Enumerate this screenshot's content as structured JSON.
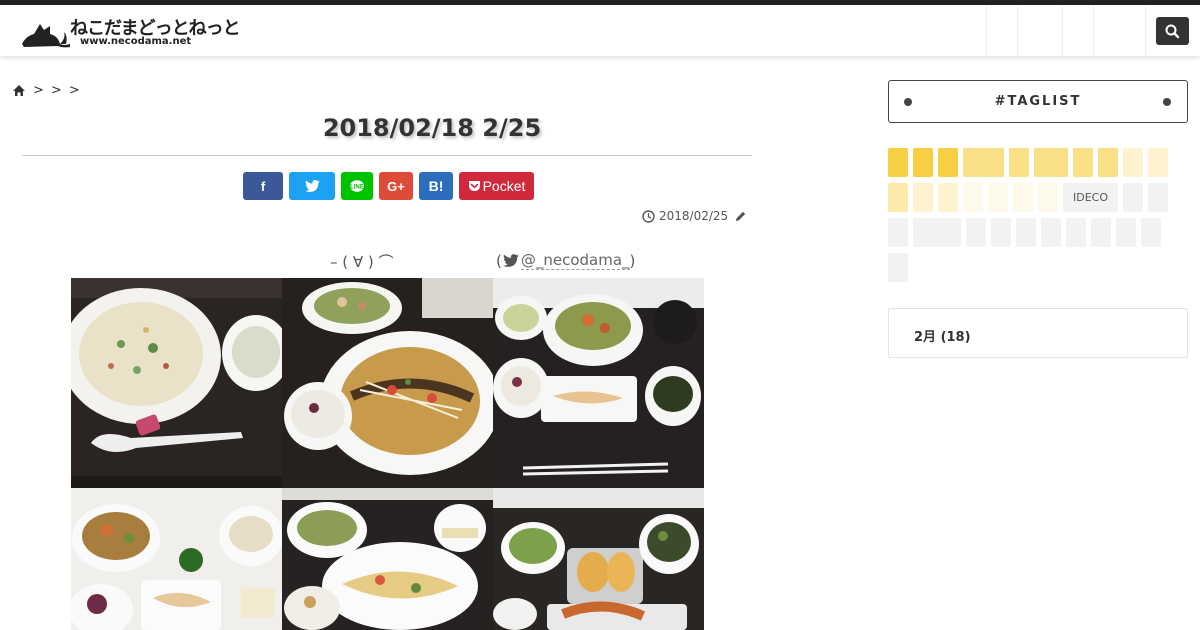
{
  "header": {
    "logo_text": "ねこだまどっとねっと",
    "logo_url": "www.necodama.net",
    "nav_count": 5
  },
  "breadcrumb": {
    "separators": [
      ">",
      ">",
      ">"
    ]
  },
  "post": {
    "title": "2018/02/18 2/25",
    "date": "2018/02/25",
    "caption": "– ( ∀ ) ⌒",
    "caption_handle_open": "(",
    "caption_handle": "@_necodama_",
    "caption_handle_close": ")"
  },
  "share": {
    "facebook": "f",
    "twitter": "t",
    "line": "L",
    "googleplus": "G+",
    "hatena": "B!",
    "pocket": "Pocket"
  },
  "sidebar": {
    "taglist_title": "#TAGLIST",
    "tag_visible_label": "IDECO",
    "archive_label": "2月 (18)"
  },
  "colors": {
    "accent_dark": "#222222",
    "tag_hot": "#f6cf45",
    "tag_warm": "#f9df86",
    "tag_mild": "#fbeaa9",
    "tag_light": "#fdf3cf",
    "tag_faint": "#fefae9",
    "tag_gray": "#f2f2f2"
  },
  "icons": {
    "home": "home-icon",
    "search": "search-icon",
    "clock": "clock-icon",
    "pencil": "pencil-icon",
    "twitter_bird": "twitter-icon"
  }
}
